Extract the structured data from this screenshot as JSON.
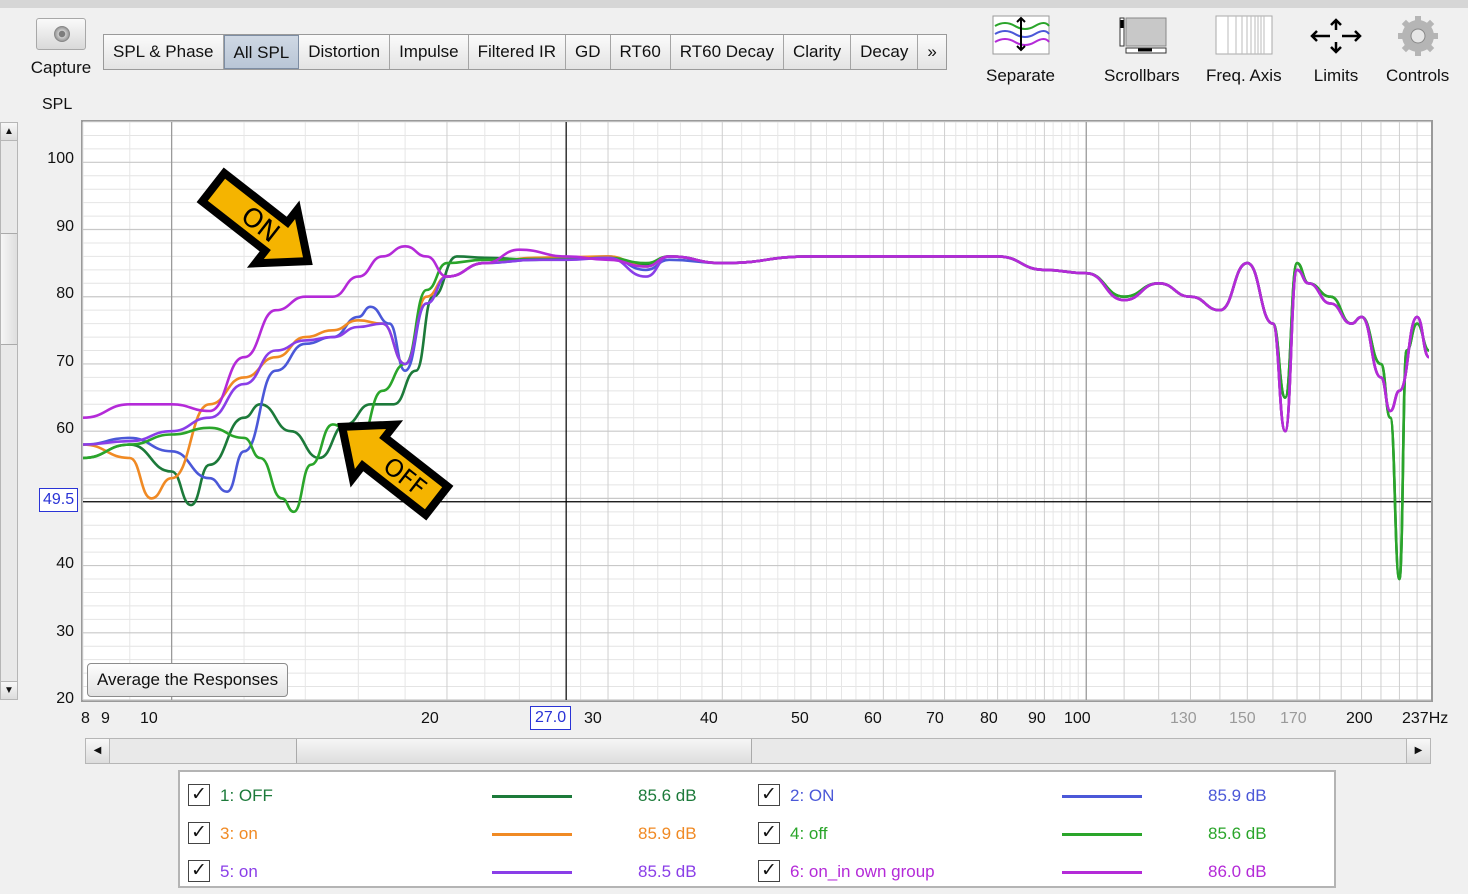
{
  "toolbar": {
    "capture_label": "Capture",
    "tabs": [
      "SPL & Phase",
      "All SPL",
      "Distortion",
      "Impulse",
      "Filtered IR",
      "GD",
      "RT60",
      "RT60 Decay",
      "Clarity",
      "Decay",
      "»"
    ],
    "active_tab": "All SPL",
    "tools": [
      "Separate",
      "Scrollbars",
      "Freq. Axis",
      "Limits",
      "Controls"
    ]
  },
  "plot": {
    "y_axis_label": "SPL",
    "y_ticks": [
      "100",
      "90",
      "80",
      "70",
      "60",
      "40",
      "30",
      "20"
    ],
    "x_ticks": [
      "8",
      "9",
      "10",
      "20",
      "30",
      "40",
      "50",
      "60",
      "70",
      "80",
      "90",
      "100",
      "130",
      "150",
      "170",
      "200",
      "237Hz"
    ],
    "x_faint_ticks": [
      "130",
      "150",
      "170"
    ],
    "cursor_x": "27.0",
    "cursor_y": "49.5",
    "average_button": "Average the Responses",
    "annotations": {
      "on": "ON",
      "off": "OFF"
    },
    "colors": {
      "grid": "#d8d8d8",
      "arrow_fill": "#f5b400",
      "cursor": "#2a33d6"
    }
  },
  "chart_data": {
    "type": "line",
    "title": "",
    "xlabel": "Hz",
    "ylabel": "SPL",
    "x_scale": "log",
    "xlim": [
      8,
      237
    ],
    "ylim": [
      20,
      106
    ],
    "grid": true,
    "series": [
      {
        "name": "1: OFF",
        "color": "#1c7a3a",
        "points": [
          [
            8,
            56
          ],
          [
            9,
            58
          ],
          [
            10,
            54
          ],
          [
            10.5,
            49
          ],
          [
            11,
            55
          ],
          [
            12,
            62
          ],
          [
            12.5,
            64
          ],
          [
            13.5,
            60
          ],
          [
            14.5,
            56
          ],
          [
            15.5,
            61
          ],
          [
            16.5,
            64
          ],
          [
            17.5,
            64
          ],
          [
            18.5,
            69
          ],
          [
            19.3,
            80
          ],
          [
            20.5,
            86
          ],
          [
            22,
            85.8
          ],
          [
            25,
            85.5
          ],
          [
            27,
            85.7
          ],
          [
            30,
            85.8
          ],
          [
            33,
            84.8
          ],
          [
            35,
            86
          ],
          [
            40,
            85
          ],
          [
            50,
            86
          ],
          [
            60,
            86
          ],
          [
            70,
            86
          ],
          [
            80,
            86
          ],
          [
            90,
            84
          ],
          [
            100,
            83.5
          ],
          [
            110,
            80
          ],
          [
            120,
            82
          ],
          [
            130,
            80
          ],
          [
            140,
            78
          ],
          [
            150,
            85
          ],
          [
            160,
            76
          ],
          [
            165,
            65
          ],
          [
            170,
            85
          ],
          [
            175,
            82
          ],
          [
            185,
            80
          ],
          [
            195,
            76
          ],
          [
            200,
            77
          ],
          [
            210,
            70
          ],
          [
            215,
            62
          ],
          [
            220,
            38
          ],
          [
            224,
            72
          ],
          [
            230,
            76
          ],
          [
            237,
            72
          ]
        ]
      },
      {
        "name": "2: ON",
        "color": "#4b58d8",
        "points": [
          [
            8,
            58
          ],
          [
            9,
            59
          ],
          [
            10,
            57
          ],
          [
            11,
            53
          ],
          [
            11.5,
            51
          ],
          [
            12,
            57
          ],
          [
            13,
            69
          ],
          [
            14,
            73
          ],
          [
            15,
            74
          ],
          [
            16,
            77
          ],
          [
            16.5,
            78.5
          ],
          [
            17.3,
            76
          ],
          [
            18,
            69
          ],
          [
            19,
            79
          ],
          [
            20,
            83
          ],
          [
            22,
            85
          ],
          [
            25,
            85.5
          ],
          [
            27,
            85.6
          ],
          [
            30,
            86
          ],
          [
            33,
            84
          ],
          [
            35,
            85.5
          ],
          [
            40,
            85
          ],
          [
            50,
            86
          ],
          [
            60,
            86
          ],
          [
            70,
            86
          ],
          [
            80,
            86
          ],
          [
            90,
            84
          ],
          [
            100,
            83.5
          ],
          [
            110,
            79.5
          ],
          [
            120,
            82
          ],
          [
            130,
            80
          ],
          [
            140,
            78
          ],
          [
            150,
            85
          ],
          [
            160,
            76
          ],
          [
            165,
            60
          ],
          [
            170,
            84
          ],
          [
            175,
            82
          ],
          [
            185,
            79
          ],
          [
            195,
            76
          ],
          [
            200,
            77
          ],
          [
            210,
            68
          ],
          [
            215,
            63
          ],
          [
            220,
            66
          ],
          [
            230,
            77
          ],
          [
            237,
            71
          ]
        ]
      },
      {
        "name": "3: on",
        "color": "#f08a24",
        "points": [
          [
            8,
            58
          ],
          [
            9,
            56
          ],
          [
            9.5,
            50
          ],
          [
            10,
            53
          ],
          [
            11,
            64
          ],
          [
            12,
            68
          ],
          [
            13,
            71
          ],
          [
            14,
            74
          ],
          [
            15,
            75
          ],
          [
            16,
            76.5
          ],
          [
            17,
            76
          ],
          [
            18,
            70
          ],
          [
            19,
            80
          ],
          [
            20,
            83
          ],
          [
            22,
            85
          ],
          [
            25,
            85.8
          ],
          [
            27,
            85.9
          ],
          [
            30,
            86
          ],
          [
            33,
            84.5
          ],
          [
            35,
            86
          ],
          [
            40,
            85
          ],
          [
            50,
            86
          ],
          [
            60,
            86
          ],
          [
            70,
            86
          ],
          [
            80,
            86
          ],
          [
            90,
            84
          ],
          [
            100,
            83.5
          ],
          [
            110,
            79.5
          ],
          [
            120,
            82
          ],
          [
            130,
            80
          ],
          [
            140,
            78
          ],
          [
            150,
            85
          ],
          [
            160,
            76
          ],
          [
            165,
            60
          ],
          [
            170,
            84
          ],
          [
            175,
            82
          ],
          [
            185,
            79
          ],
          [
            195,
            76
          ],
          [
            200,
            77
          ],
          [
            210,
            68
          ],
          [
            215,
            63
          ],
          [
            220,
            66
          ],
          [
            230,
            77
          ],
          [
            237,
            71
          ]
        ]
      },
      {
        "name": "4: off",
        "color": "#2aa52a",
        "points": [
          [
            8,
            56
          ],
          [
            9,
            58
          ],
          [
            10,
            59.5
          ],
          [
            11,
            60.5
          ],
          [
            12,
            59
          ],
          [
            12.5,
            56
          ],
          [
            13.2,
            50
          ],
          [
            13.6,
            48
          ],
          [
            14.2,
            55
          ],
          [
            15,
            61
          ],
          [
            16,
            58
          ],
          [
            17,
            66
          ],
          [
            18,
            70
          ],
          [
            19,
            81
          ],
          [
            20,
            85
          ],
          [
            22,
            85.5
          ],
          [
            25,
            85.6
          ],
          [
            27,
            85.6
          ],
          [
            30,
            85.8
          ],
          [
            33,
            85
          ],
          [
            35,
            86
          ],
          [
            40,
            85
          ],
          [
            50,
            86
          ],
          [
            60,
            86
          ],
          [
            70,
            86
          ],
          [
            80,
            86
          ],
          [
            90,
            84
          ],
          [
            100,
            83.5
          ],
          [
            110,
            80
          ],
          [
            120,
            82
          ],
          [
            130,
            80
          ],
          [
            140,
            78
          ],
          [
            150,
            85
          ],
          [
            160,
            76
          ],
          [
            165,
            65
          ],
          [
            170,
            85
          ],
          [
            175,
            82
          ],
          [
            185,
            80
          ],
          [
            195,
            76
          ],
          [
            200,
            77
          ],
          [
            210,
            70
          ],
          [
            215,
            62
          ],
          [
            220,
            38
          ],
          [
            224,
            72
          ],
          [
            230,
            76
          ],
          [
            237,
            72
          ]
        ]
      },
      {
        "name": "5: on",
        "color": "#8a3ee8",
        "points": [
          [
            8,
            58
          ],
          [
            9,
            58.5
          ],
          [
            10,
            60
          ],
          [
            11,
            62
          ],
          [
            12,
            67
          ],
          [
            13,
            72
          ],
          [
            14,
            73.5
          ],
          [
            15,
            74
          ],
          [
            16,
            75.5
          ],
          [
            17,
            76
          ],
          [
            18,
            70
          ],
          [
            19,
            79
          ],
          [
            20,
            83
          ],
          [
            22,
            85
          ],
          [
            25,
            85.5
          ],
          [
            27,
            85.5
          ],
          [
            30,
            85.8
          ],
          [
            33,
            83
          ],
          [
            35,
            86
          ],
          [
            40,
            85
          ],
          [
            50,
            86
          ],
          [
            60,
            86
          ],
          [
            70,
            86
          ],
          [
            80,
            86
          ],
          [
            90,
            84
          ],
          [
            100,
            83.5
          ],
          [
            110,
            79.5
          ],
          [
            120,
            82
          ],
          [
            130,
            80
          ],
          [
            140,
            78
          ],
          [
            150,
            85
          ],
          [
            160,
            76
          ],
          [
            165,
            60
          ],
          [
            170,
            84
          ],
          [
            175,
            82
          ],
          [
            185,
            79
          ],
          [
            195,
            76
          ],
          [
            200,
            77
          ],
          [
            210,
            68
          ],
          [
            215,
            63
          ],
          [
            220,
            66
          ],
          [
            230,
            77
          ],
          [
            237,
            71
          ]
        ]
      },
      {
        "name": "6: on_in own group",
        "color": "#b42ad8",
        "points": [
          [
            8,
            62
          ],
          [
            9,
            64
          ],
          [
            10,
            64
          ],
          [
            11,
            63
          ],
          [
            12,
            71
          ],
          [
            13,
            78
          ],
          [
            14,
            80
          ],
          [
            15,
            80
          ],
          [
            16,
            83
          ],
          [
            17,
            86
          ],
          [
            18,
            87.5
          ],
          [
            19,
            86
          ],
          [
            20,
            83
          ],
          [
            22,
            85
          ],
          [
            24,
            87
          ],
          [
            27,
            86
          ],
          [
            30,
            85.5
          ],
          [
            33,
            84.5
          ],
          [
            35,
            86
          ],
          [
            40,
            85
          ],
          [
            50,
            86
          ],
          [
            60,
            86
          ],
          [
            70,
            86
          ],
          [
            80,
            86
          ],
          [
            90,
            84
          ],
          [
            100,
            83.5
          ],
          [
            110,
            79.5
          ],
          [
            120,
            82
          ],
          [
            130,
            80
          ],
          [
            140,
            78
          ],
          [
            150,
            85
          ],
          [
            160,
            76
          ],
          [
            165,
            60
          ],
          [
            170,
            84
          ],
          [
            175,
            82
          ],
          [
            185,
            79
          ],
          [
            195,
            76
          ],
          [
            200,
            77
          ],
          [
            210,
            68
          ],
          [
            215,
            63
          ],
          [
            220,
            66
          ],
          [
            230,
            77
          ],
          [
            237,
            71
          ]
        ]
      }
    ]
  },
  "legend": {
    "items": [
      {
        "id": "1",
        "label": "1: OFF",
        "value": "85.6 dB",
        "color": "#1c7a3a",
        "text_color": "#1c7a3a",
        "checked": true
      },
      {
        "id": "2",
        "label": "2: ON",
        "value": "85.9 dB",
        "color": "#4b58d8",
        "text_color": "#4b58d8",
        "checked": true
      },
      {
        "id": "3",
        "label": "3: on",
        "value": "85.9 dB",
        "color": "#f08a24",
        "text_color": "#f08a24",
        "checked": true
      },
      {
        "id": "4",
        "label": "4: off",
        "value": "85.6 dB",
        "color": "#2aa52a",
        "text_color": "#2aa52a",
        "checked": true
      },
      {
        "id": "5",
        "label": "5: on",
        "value": "85.5 dB",
        "color": "#8a3ee8",
        "text_color": "#8a3ee8",
        "checked": true
      },
      {
        "id": "6",
        "label": "6: on_in own group",
        "value": "86.0 dB",
        "color": "#b42ad8",
        "text_color": "#b42ad8",
        "checked": true
      }
    ]
  }
}
